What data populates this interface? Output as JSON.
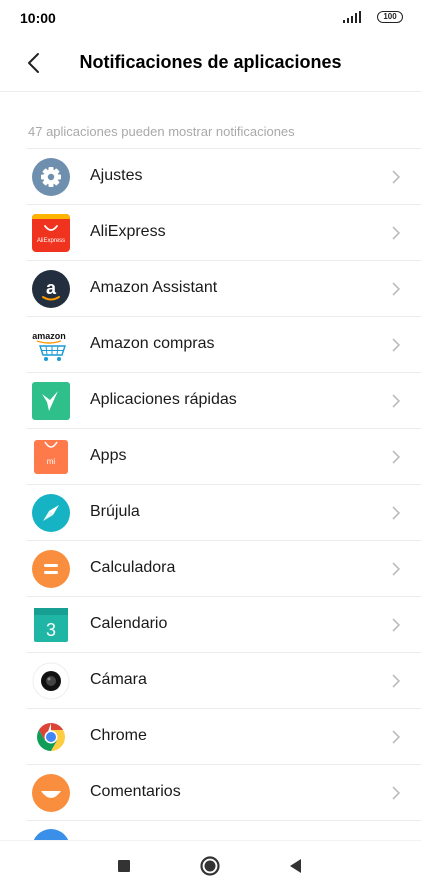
{
  "status": {
    "time": "10:00",
    "battery": "100"
  },
  "header": {
    "title": "Notificaciones de aplicaciones"
  },
  "caption": "47 aplicaciones pueden mostrar notificaciones",
  "apps": [
    {
      "label": "Ajustes"
    },
    {
      "label": "AliExpress",
      "icon_text": "AliExpress"
    },
    {
      "label": "Amazon Assistant"
    },
    {
      "label": "Amazon compras",
      "icon_text": "amazon"
    },
    {
      "label": "Aplicaciones rápidas"
    },
    {
      "label": "Apps",
      "icon_text": "mi"
    },
    {
      "label": "Brújula"
    },
    {
      "label": "Calculadora"
    },
    {
      "label": "Calendario",
      "icon_text": "3"
    },
    {
      "label": "Cámara"
    },
    {
      "label": "Chrome"
    },
    {
      "label": "Comentarios"
    }
  ],
  "colors": {
    "ajustes": "#6f8fae",
    "aliexpress": "#f0331e",
    "amazon_dark": "#232f3e",
    "amazon_orange": "#ff9900",
    "quick_apps": "#2ebf8b",
    "apps": "#ff7a4a",
    "compass": "#15b3c4",
    "calculator": "#f98e3f",
    "calendar": "#1fb6a6",
    "comments": "#f98e3f",
    "peek": "#3a8fe8"
  }
}
